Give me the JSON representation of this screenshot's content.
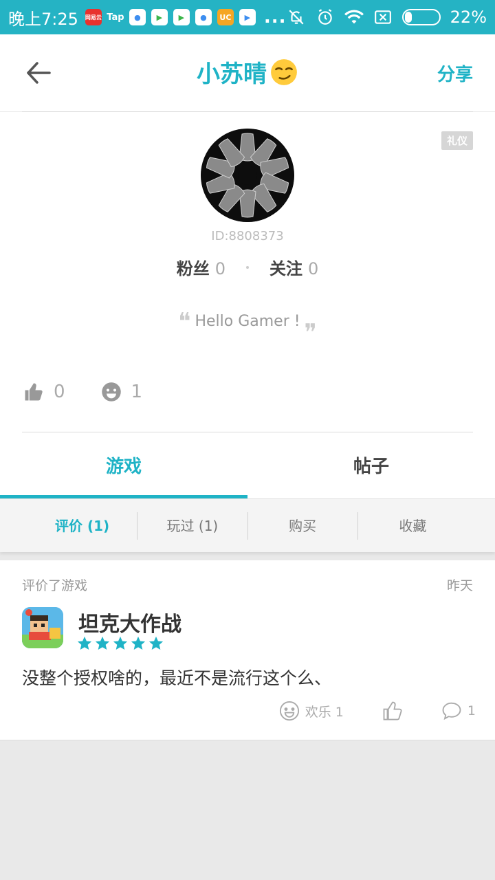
{
  "status_bar": {
    "time": "晚上7:25",
    "apps": [
      "网易云",
      "Tap",
      "●",
      "▶",
      "▶",
      "●",
      "UC",
      "▶"
    ],
    "more": "...",
    "battery_text": "22%",
    "battery_level": 0.22,
    "accent": "#25b3c4"
  },
  "header": {
    "title": "小苏晴",
    "share_label": "分享"
  },
  "profile": {
    "badge": "礼仪",
    "id_text": "ID:8808373",
    "followers_label": "粉丝",
    "followers_count": "0",
    "following_label": "关注",
    "following_count": "0",
    "bio": "Hello Gamer !",
    "likes_count": "0",
    "fun_count": "1"
  },
  "tabs": [
    {
      "label": "游戏",
      "active": true
    },
    {
      "label": "帖子",
      "active": false
    }
  ],
  "subtabs": [
    {
      "label": "评价 (1)",
      "active": true
    },
    {
      "label": "玩过 (1)",
      "active": false
    },
    {
      "label": "购买",
      "active": false
    },
    {
      "label": "收藏",
      "active": false
    }
  ],
  "review_card": {
    "kind": "评价了游戏",
    "time": "昨天",
    "game_name": "坦克大作战",
    "rating": 5,
    "text": "没整个授权啥的，最近不是流行这个么、",
    "fun_label": "欢乐 1",
    "comments_count": "1"
  },
  "colors": {
    "accent": "#1fb3c6",
    "background": "#e9e9e9"
  }
}
